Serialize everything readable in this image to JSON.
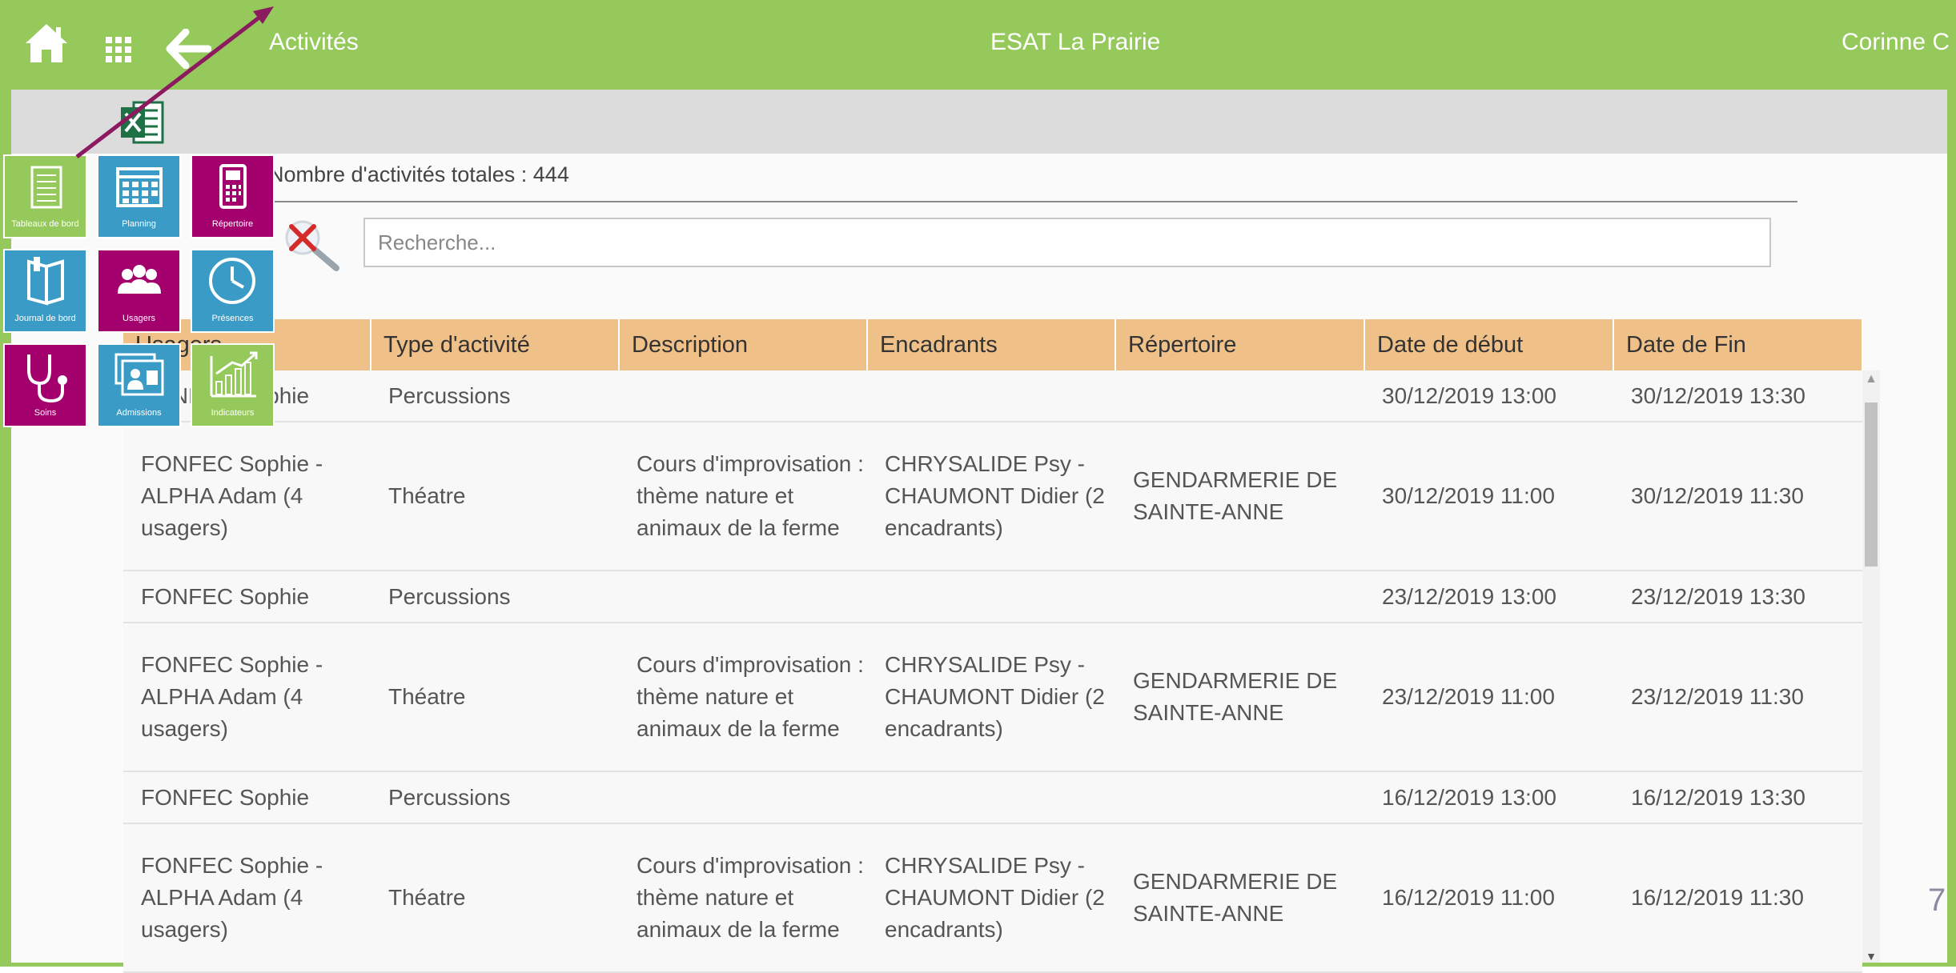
{
  "header": {
    "section_title": "Activités",
    "org_name": "ESAT La Prairie",
    "user_name": "Corinne C"
  },
  "toolbar": {
    "excel_icon": "excel-export-icon"
  },
  "summary": {
    "count_text": "Nombre d'activités totales : 444"
  },
  "search": {
    "placeholder": "Recherche...",
    "value": ""
  },
  "table": {
    "columns": [
      "Usagers",
      "Type d'activité",
      "Description",
      "Encadrants",
      "Répertoire",
      "Date de début",
      "Date de Fin"
    ],
    "rows": [
      {
        "usagers": "FONFEC Sophie",
        "type": "Percussions",
        "description": "",
        "encadrants": "",
        "repertoire": "",
        "debut": "30/12/2019 13:00",
        "fin": "30/12/2019 13:30"
      },
      {
        "usagers": "FONFEC Sophie - ALPHA Adam (4 usagers)",
        "type": "Théatre",
        "description": "Cours d'improvisation : thème nature et animaux de la ferme",
        "encadrants": "CHRYSALIDE Psy - CHAUMONT Didier (2 encadrants)",
        "repertoire": "GENDARMERIE DE SAINTE-ANNE",
        "debut": "30/12/2019 11:00",
        "fin": "30/12/2019 11:30"
      },
      {
        "usagers": "FONFEC Sophie",
        "type": "Percussions",
        "description": "",
        "encadrants": "",
        "repertoire": "",
        "debut": "23/12/2019 13:00",
        "fin": "23/12/2019 13:30"
      },
      {
        "usagers": "FONFEC Sophie - ALPHA Adam (4 usagers)",
        "type": "Théatre",
        "description": "Cours d'improvisation : thème nature et animaux de la ferme",
        "encadrants": "CHRYSALIDE Psy - CHAUMONT Didier (2 encadrants)",
        "repertoire": "GENDARMERIE DE SAINTE-ANNE",
        "debut": "23/12/2019 11:00",
        "fin": "23/12/2019 11:30"
      },
      {
        "usagers": "FONFEC Sophie",
        "type": "Percussions",
        "description": "",
        "encadrants": "",
        "repertoire": "",
        "debut": "16/12/2019 13:00",
        "fin": "16/12/2019 13:30"
      },
      {
        "usagers": "FONFEC Sophie - ALPHA Adam (4 usagers)",
        "type": "Théatre",
        "description": "Cours d'improvisation : thème nature et animaux de la ferme",
        "encadrants": "CHRYSALIDE Psy - CHAUMONT Didier (2 encadrants)",
        "repertoire": "GENDARMERIE DE SAINTE-ANNE",
        "debut": "16/12/2019 11:00",
        "fin": "16/12/2019 11:30"
      }
    ]
  },
  "menu_tiles": [
    {
      "label": "Tableaux de bord",
      "color": "#96c95c",
      "icon": "dashboard-icon"
    },
    {
      "label": "Planning",
      "color": "#3a9cc6",
      "icon": "calendar-icon"
    },
    {
      "label": "Répertoire",
      "color": "#a4006d",
      "icon": "phone-icon"
    },
    {
      "label": "Journal de bord",
      "color": "#3a9cc6",
      "icon": "journal-icon"
    },
    {
      "label": "Usagers",
      "color": "#a4006d",
      "icon": "users-icon"
    },
    {
      "label": "Présences",
      "color": "#3a9cc6",
      "icon": "clock-icon"
    },
    {
      "label": "Soins",
      "color": "#a4006d",
      "icon": "stethoscope-icon"
    },
    {
      "label": "Admissions",
      "color": "#3a9cc6",
      "icon": "admissions-icon"
    },
    {
      "label": "Indicateurs",
      "color": "#96c95c",
      "icon": "chart-icon"
    }
  ],
  "page_number": "7",
  "colors": {
    "brand_green": "#96c95c",
    "header_orange": "#efc088",
    "magenta": "#a4006d",
    "blue": "#3a9cc6",
    "arrow": "#8b1a5e"
  }
}
